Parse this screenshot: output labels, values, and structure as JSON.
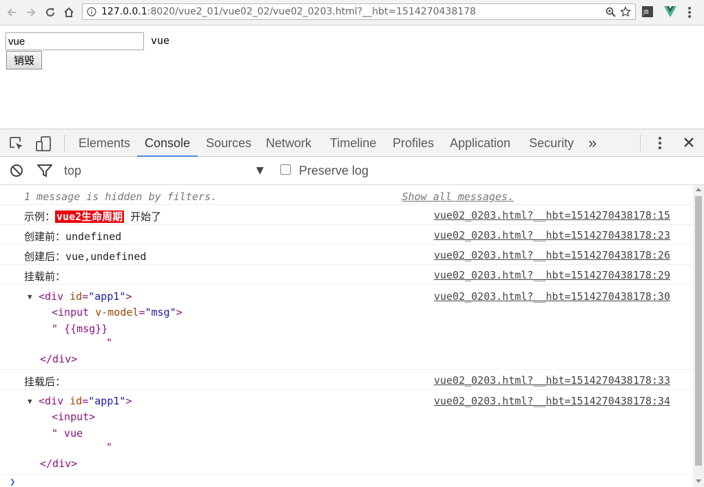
{
  "browser": {
    "url_host": "127.0.0.1",
    "url_path": ":8020/vue2_01/vue02_02/vue02_0203.html?__hbt=1514270438178",
    "extension_badge": "JB"
  },
  "page": {
    "input_value": "vue",
    "echo_text": "vue",
    "destroy_button_label": "销毁"
  },
  "devtools": {
    "tabs": [
      "Elements",
      "Console",
      "Sources",
      "Network",
      "Timeline",
      "Profiles",
      "Application",
      "Security"
    ],
    "active_tab": "Console",
    "more_tabs_glyph": "»",
    "context": "top",
    "preserve_log_label": "Preserve log",
    "preserve_log_checked": false
  },
  "console": {
    "hidden_notice": "1 message is hidden by filters.",
    "show_all_link": "Show all messages.",
    "messages": [
      {
        "prefix": "示例：",
        "highlight": "vue2生命周期",
        "suffix": " 开始了",
        "source": "vue02_0203.html?__hbt=1514270438178:15"
      },
      {
        "text": "创建前：undefined",
        "source": "vue02_0203.html?__hbt=1514270438178:23"
      },
      {
        "text": "创建后：vue,undefined",
        "source": "vue02_0203.html?__hbt=1514270438178:26"
      },
      {
        "text": "挂载前：",
        "source": "vue02_0203.html?__hbt=1514270438178:29"
      },
      {
        "source": "vue02_0203.html?__hbt=1514270438178:30",
        "dom": {
          "open_tag": "div",
          "attr_name": "id",
          "attr_value": "\"app1\"",
          "child_tag": "input",
          "child_attr_name": "v-model",
          "child_attr_value": "\"msg\"",
          "text_line1": "\" {{msg}}",
          "text_line2": "\"",
          "close_tag": "</div>"
        }
      },
      {
        "text": "挂载后：",
        "source": "vue02_0203.html?__hbt=1514270438178:33"
      },
      {
        "source": "vue02_0203.html?__hbt=1514270438178:34",
        "dom": {
          "open_tag": "div",
          "attr_name": "id",
          "attr_value": "\"app1\"",
          "child_tag": "input",
          "text_line1": "\" vue",
          "text_line2": "\"",
          "close_tag": "</div>"
        }
      }
    ],
    "prompt_glyph": "❯"
  },
  "colors": {
    "highlight_bg": "#e8000b",
    "active_tab_underline": "#4a8ae0",
    "tag_color": "#881280",
    "attr_name_color": "#994500",
    "attr_value_color": "#1a1aa6"
  }
}
